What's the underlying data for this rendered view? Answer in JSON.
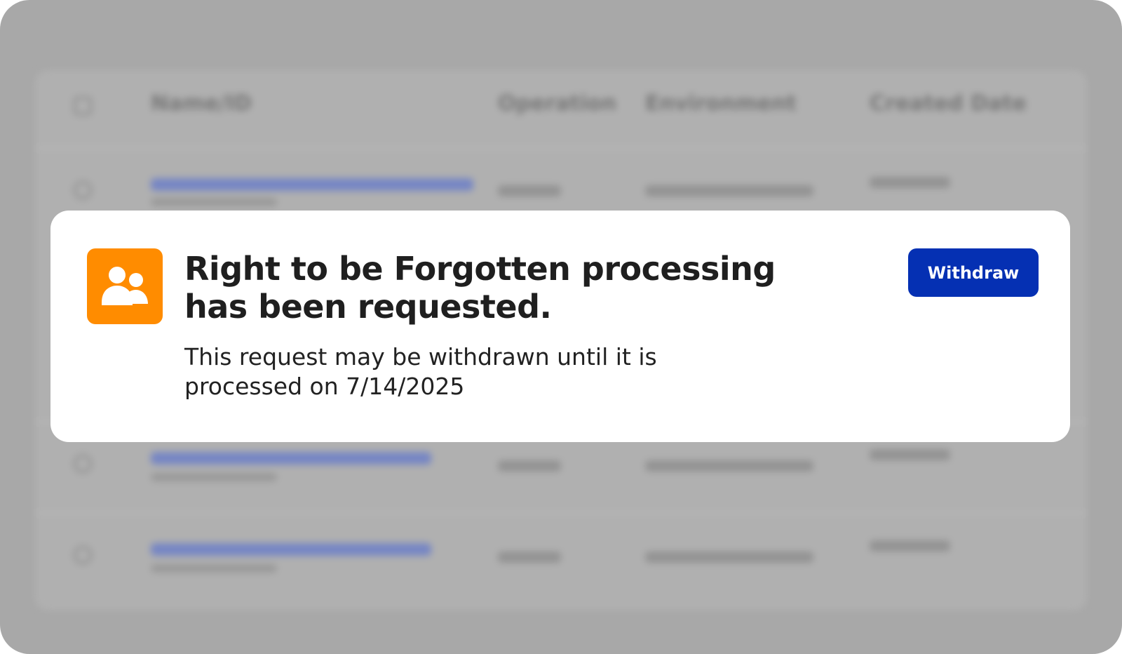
{
  "background_table": {
    "columns": [
      "Name/ID",
      "Operation",
      "Environment",
      "Created Date"
    ]
  },
  "notification": {
    "icon": "users-icon",
    "title": "Right to be Forgotten processing has been requested.",
    "message": "This request may be withdrawn until it is processed on 7/14/2025",
    "button_label": "Withdraw"
  },
  "colors": {
    "icon_bg": "#ff8c00",
    "button_bg": "#0530b3",
    "overlay": "#a8a8a8"
  }
}
